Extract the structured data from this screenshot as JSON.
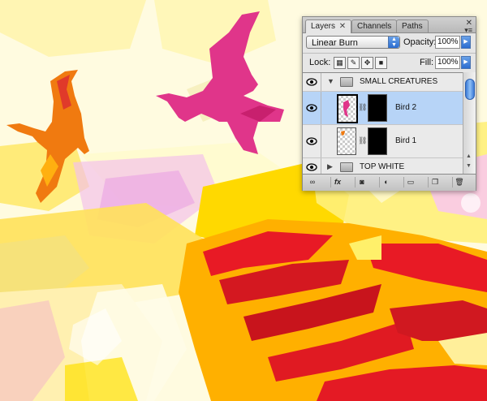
{
  "panel": {
    "tabs": [
      {
        "label": "Layers",
        "active": true,
        "close": "✕"
      },
      {
        "label": "Channels",
        "active": false
      },
      {
        "label": "Paths",
        "active": false
      }
    ],
    "blend_mode": "Linear Burn",
    "opacity_label": "Opacity:",
    "opacity_value": "100%",
    "lock_label": "Lock:",
    "fill_label": "Fill:",
    "fill_value": "100%",
    "layers": [
      {
        "name": "SMALL CREATURES",
        "type": "group",
        "expanded": true,
        "visible": true,
        "selected": false
      },
      {
        "name": "Bird 2",
        "type": "layer",
        "visible": true,
        "selected": true
      },
      {
        "name": "Bird 1",
        "type": "layer",
        "visible": true,
        "selected": false
      },
      {
        "name": "TOP WHITE",
        "type": "group",
        "expanded": false,
        "visible": true,
        "selected": false
      }
    ],
    "bottom_icons": [
      "link-icon",
      "fx-icon",
      "mask-icon",
      "adjustment-icon",
      "group-icon",
      "new-layer-icon",
      "trash-icon"
    ],
    "fx_label": "fx"
  },
  "colors": {
    "selection": "#b7d4f7",
    "accent_blue": "#2b6cd0",
    "bird_orange": "#f07a10",
    "bird_pink": "#e0358a",
    "red_stripes": "#d41820"
  }
}
